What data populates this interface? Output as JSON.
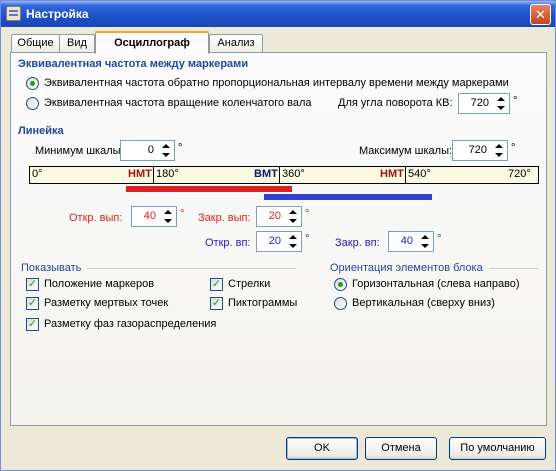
{
  "window": {
    "title": "Настройка"
  },
  "tabs": [
    "Общие",
    "Вид",
    "Осциллограф",
    "Анализ"
  ],
  "equiv": {
    "title": "Эквивалентная частота между маркерами",
    "option1": "Эквивалентная частота обратно пропорциональная интервалу времени между маркерами",
    "option2": "Эквивалентная частота вращение коленчатого вала",
    "angle_label": "Для угла поворота КВ:",
    "angle_value": "720",
    "deg": "°"
  },
  "ruler": {
    "title": "Линейка",
    "min_label": "Минимум шкалы:",
    "min_value": "0",
    "max_label": "Максимум шкалы:",
    "max_value": "720",
    "ticks": [
      "0°",
      "180°",
      "360°",
      "540°",
      "720°"
    ],
    "markers": [
      "НМТ",
      "ВМТ",
      "НМТ"
    ],
    "open_exh_label": "Откр. вып:",
    "open_exh_value": "40",
    "close_exh_label": "Закр. вып:",
    "close_exh_value": "20",
    "open_int_label": "Откр. вп:",
    "open_int_value": "20",
    "close_int_label": "Закр. вп:",
    "close_int_value": "40"
  },
  "show": {
    "title": "Показывать",
    "markers_pos": "Положение маркеров",
    "dead_points": "Разметку мертвых точек",
    "valve_phases": "Разметку фаз газораспределения",
    "arrows": "Стрелки",
    "pictograms": "Пиктограммы"
  },
  "orient": {
    "title": "Ориентация элементов блока",
    "horizontal": "Горизонтальная (слева направо)",
    "vertical": "Вертикальная (сверху вниз)"
  },
  "buttons": {
    "ok": "OK",
    "cancel": "Отмена",
    "default": "По умолчанию"
  },
  "colors": {
    "exhaust": "#e02020",
    "intake": "#2020c8",
    "section": "#21499b"
  }
}
